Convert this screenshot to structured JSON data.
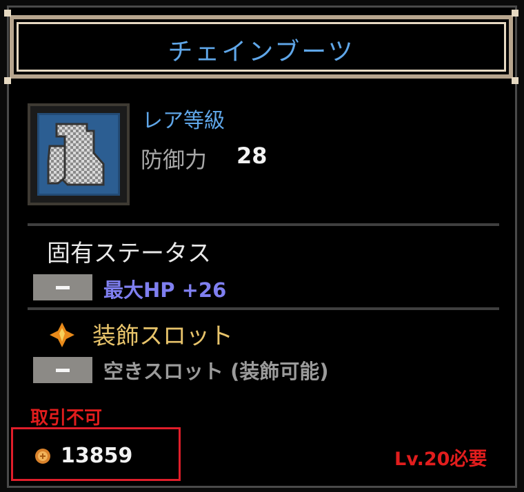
{
  "item": {
    "name": "チェインブーツ",
    "rarity": "レア等級",
    "defense_label": "防御力",
    "defense_value": "28",
    "icon": "chain-boots-icon"
  },
  "intrinsic": {
    "title": "固有ステータス",
    "stat": "最大HP +26"
  },
  "slots": {
    "title": "装飾スロット",
    "entry": "空きスロット (装飾可能)",
    "icon": "diamond-icon"
  },
  "trade_status": "取引不可",
  "price": "13859",
  "level_requirement": "Lv.20必要",
  "colors": {
    "title": "#5fa6e8",
    "stat": "#7f7ff0",
    "slot": "#e8c46b",
    "warning": "#e11d1d",
    "frame": "#b7a58e",
    "highlight_box": "#e01e2a"
  }
}
